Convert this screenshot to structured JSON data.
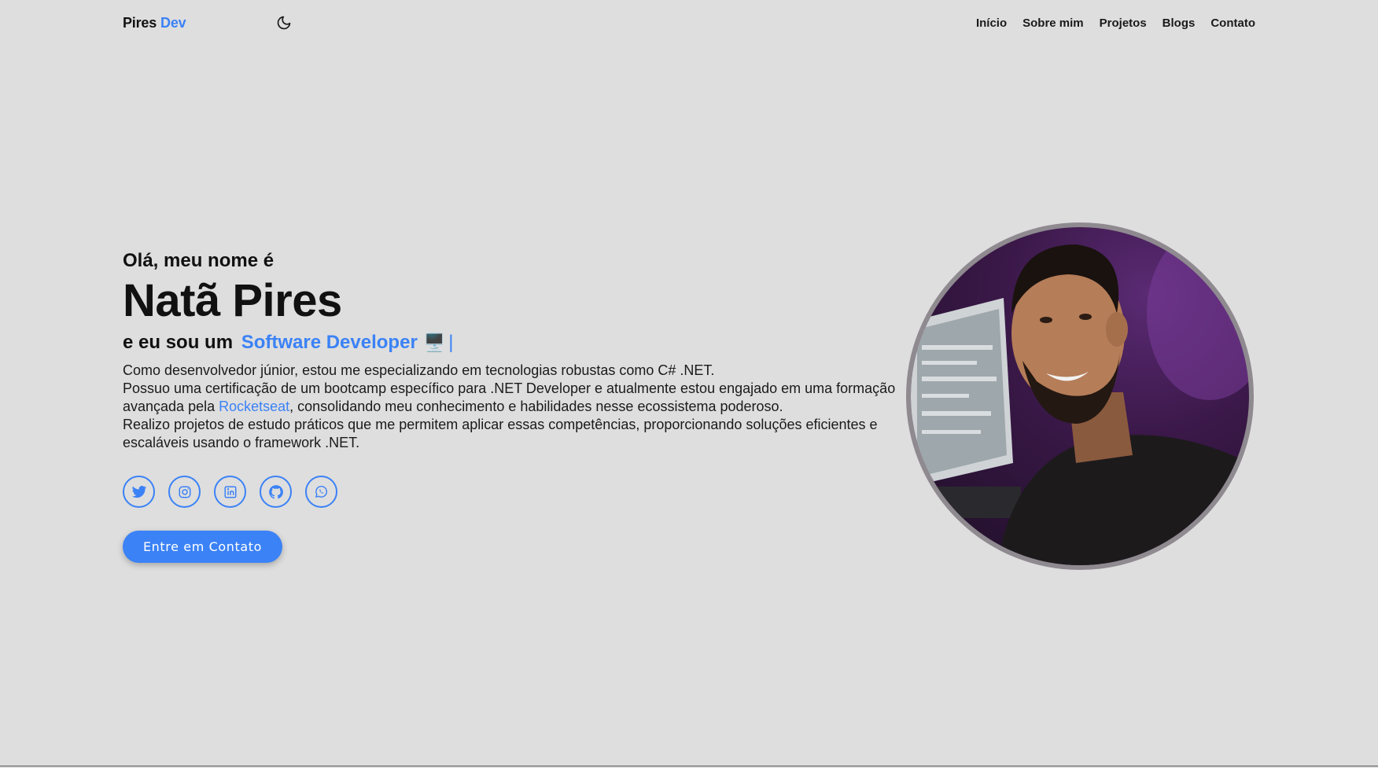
{
  "header": {
    "logo_name": "Pires",
    "logo_accent": "Dev",
    "theme_icon": "moon-icon",
    "nav": [
      {
        "label": "Início"
      },
      {
        "label": "Sobre mim"
      },
      {
        "label": "Projetos"
      },
      {
        "label": "Blogs"
      },
      {
        "label": "Contato"
      }
    ]
  },
  "hero": {
    "greeting": "Olá, meu nome é",
    "name": "Natã Pires",
    "role_prefix": "e eu sou um",
    "role": "Software Developer",
    "role_emoji": "🖥️",
    "cursor": "|",
    "paragraph1": "Como desenvolvedor júnior, estou me especializando em tecnologias robustas como C# .NET.",
    "paragraph2_before": "Possuo uma certificação de um bootcamp específico para .NET Developer e atualmente estou engajado em uma formação avançada pela ",
    "paragraph2_link": "Rocketseat",
    "paragraph2_after": ", consolidando meu conhecimento e habilidades nesse ecossistema poderoso.",
    "paragraph3": "Realizo projetos de estudo práticos que me permitem aplicar essas competências, proporcionando soluções eficientes e escaláveis usando o framework .NET.",
    "socials": [
      {
        "icon": "twitter-icon"
      },
      {
        "icon": "instagram-icon"
      },
      {
        "icon": "linkedin-icon"
      },
      {
        "icon": "github-icon"
      },
      {
        "icon": "whatsapp-icon"
      }
    ],
    "cta_label": "Entre em Contato"
  },
  "colors": {
    "background": "#dedede",
    "accent": "#3b82f6",
    "text": "#111111",
    "avatar_border": "#8f8a90"
  }
}
